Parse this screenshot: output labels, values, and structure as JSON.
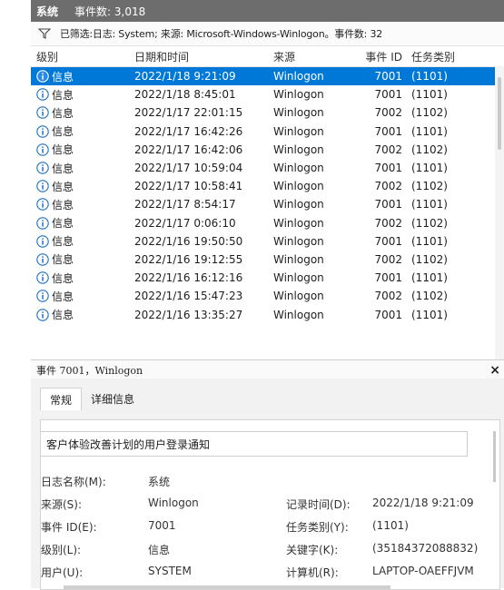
{
  "header": {
    "title": "系统",
    "event_count": "事件数: 3,018"
  },
  "filter": {
    "text": "已筛选:日志: System; 来源: Microsoft-Windows-Winlogon。事件数: 32"
  },
  "table": {
    "columns": [
      "级别",
      "日期和时间",
      "来源",
      "事件 ID",
      "任务类别"
    ],
    "rows": [
      {
        "level": "信息",
        "datetime": "2022/1/18 9:21:09",
        "source": "Winlogon",
        "id": "7001",
        "category": "(1101)"
      },
      {
        "level": "信息",
        "datetime": "2022/1/18 8:45:01",
        "source": "Winlogon",
        "id": "7001",
        "category": "(1101)"
      },
      {
        "level": "信息",
        "datetime": "2022/1/17 22:01:15",
        "source": "Winlogon",
        "id": "7002",
        "category": "(1102)"
      },
      {
        "level": "信息",
        "datetime": "2022/1/17 16:42:26",
        "source": "Winlogon",
        "id": "7001",
        "category": "(1101)"
      },
      {
        "level": "信息",
        "datetime": "2022/1/17 16:42:06",
        "source": "Winlogon",
        "id": "7002",
        "category": "(1102)"
      },
      {
        "level": "信息",
        "datetime": "2022/1/17 10:59:04",
        "source": "Winlogon",
        "id": "7001",
        "category": "(1101)"
      },
      {
        "level": "信息",
        "datetime": "2022/1/17 10:58:41",
        "source": "Winlogon",
        "id": "7002",
        "category": "(1102)"
      },
      {
        "level": "信息",
        "datetime": "2022/1/17 8:54:17",
        "source": "Winlogon",
        "id": "7001",
        "category": "(1101)"
      },
      {
        "level": "信息",
        "datetime": "2022/1/17 0:06:10",
        "source": "Winlogon",
        "id": "7002",
        "category": "(1102)"
      },
      {
        "level": "信息",
        "datetime": "2022/1/16 19:50:50",
        "source": "Winlogon",
        "id": "7001",
        "category": "(1101)"
      },
      {
        "level": "信息",
        "datetime": "2022/1/16 19:12:55",
        "source": "Winlogon",
        "id": "7002",
        "category": "(1102)"
      },
      {
        "level": "信息",
        "datetime": "2022/1/16 16:12:16",
        "source": "Winlogon",
        "id": "7001",
        "category": "(1101)"
      },
      {
        "level": "信息",
        "datetime": "2022/1/16 15:47:23",
        "source": "Winlogon",
        "id": "7002",
        "category": "(1102)"
      },
      {
        "level": "信息",
        "datetime": "2022/1/16 13:35:27",
        "source": "Winlogon",
        "id": "7001",
        "category": "(1101)"
      }
    ]
  },
  "detail": {
    "title": "事件 7001，Winlogon",
    "close": "×",
    "tabs": [
      "常规",
      "详细信息"
    ],
    "description": "客户体验改善计划的用户登录通知",
    "fields": {
      "log_name_label": "日志名称(M):",
      "log_name": "系统",
      "source_label": "来源(S):",
      "source": "Winlogon",
      "logged_label": "记录时间(D):",
      "logged": "2022/1/18 9:21:09",
      "event_id_label": "事件 ID(E):",
      "event_id": "7001",
      "task_label": "任务类别(Y):",
      "task": "(1101)",
      "level_label": "级别(L):",
      "level": "信息",
      "keywords_label": "关键字(K):",
      "keywords": "(35184372088832)",
      "user_label": "用户(U):",
      "user": "SYSTEM",
      "computer_label": "计算机(R):",
      "computer": "LAPTOP-OAEFFJVM"
    }
  },
  "colors": {
    "selection": "#0078d7",
    "header_bg": "#6d6d6d",
    "info_icon": "#1a6fc9"
  }
}
